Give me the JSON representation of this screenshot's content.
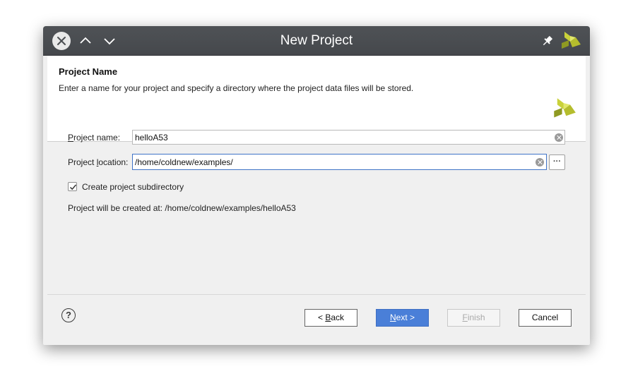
{
  "window": {
    "title": "New Project"
  },
  "header": {
    "title": "Project Name",
    "description": "Enter a name for your project and specify a directory where the project data files will be stored."
  },
  "form": {
    "project_name": {
      "label_mnemonic": "P",
      "label_rest": "roject name:",
      "value": "helloA53"
    },
    "project_location": {
      "label_before": "Project ",
      "label_mnemonic": "l",
      "label_after": "ocation:",
      "value": "/home/coldnew/examples/"
    },
    "browse_label": "···",
    "create_subdirectory": {
      "label": "Create project subdirectory",
      "checked": true
    },
    "result_text": "Project will be created at: /home/coldnew/examples/helloA53"
  },
  "footer": {
    "help_label": "?",
    "back": {
      "before": "< ",
      "mnemonic": "B",
      "after": "ack"
    },
    "next": {
      "mnemonic": "N",
      "after": "ext >"
    },
    "finish": {
      "mnemonic": "F",
      "after": "inish"
    },
    "cancel": "Cancel"
  },
  "colors": {
    "titlebar": "#4b4e52",
    "accent": "#4a7fd8",
    "focus_border": "#3f73c7",
    "logo_green": "#b5bd2d"
  },
  "icons": [
    "close-icon",
    "chevron-up-icon",
    "chevron-down-icon",
    "pin-icon",
    "vivado-logo-icon",
    "clear-icon",
    "checkmark-icon",
    "help-icon"
  ]
}
